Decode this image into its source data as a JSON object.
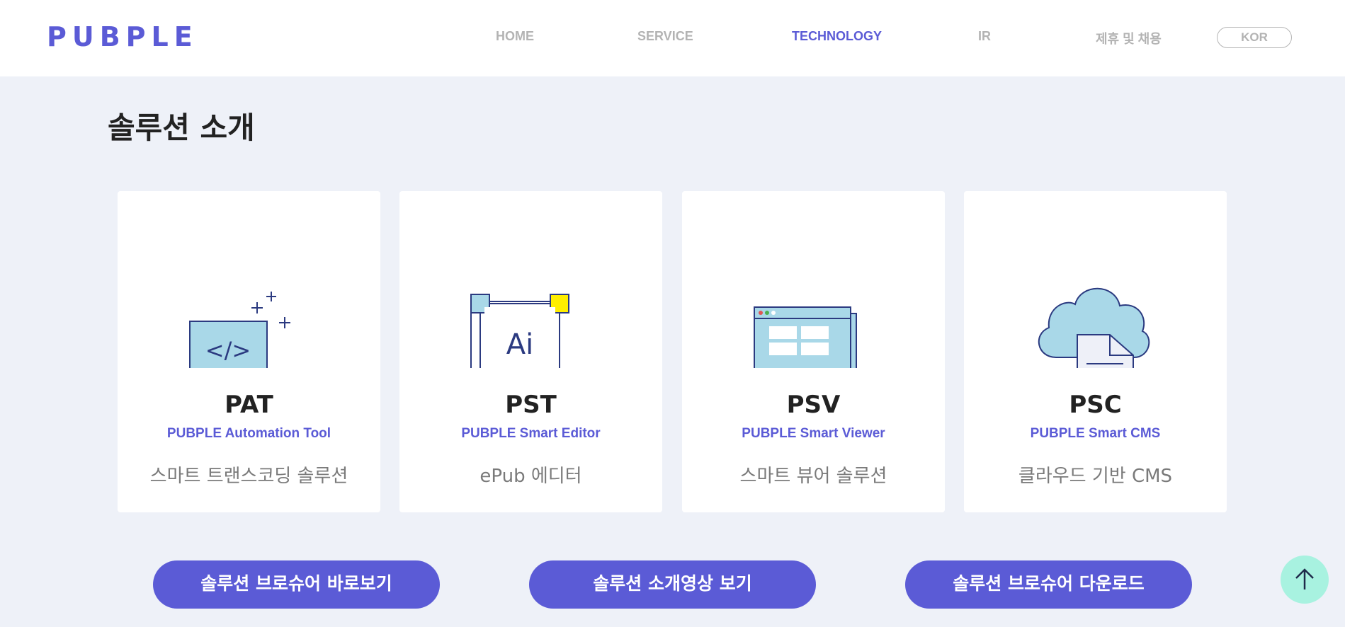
{
  "header": {
    "logo": "PUBPLE",
    "nav": [
      {
        "label": "HOME",
        "active": false
      },
      {
        "label": "SERVICE",
        "active": false
      },
      {
        "label": "TECHNOLOGY",
        "active": true
      },
      {
        "label": "IR",
        "active": false
      },
      {
        "label": "제휴 및 채용",
        "active": false
      }
    ],
    "language": "KOR"
  },
  "section": {
    "title": "솔루션 소개"
  },
  "solutions": [
    {
      "code": "PAT",
      "subtitle": "PUBPLE Automation Tool",
      "description": "스마트 트랜스코딩 솔루션",
      "icon": "monitor-code-icon"
    },
    {
      "code": "PST",
      "subtitle": "PUBPLE Smart Editor",
      "description": "ePub 에디터",
      "icon": "ai-editor-icon"
    },
    {
      "code": "PSV",
      "subtitle": "PUBPLE Smart Viewer",
      "description": "스마트 뷰어 솔루션",
      "icon": "browser-window-icon"
    },
    {
      "code": "PSC",
      "subtitle": "PUBPLE Smart CMS",
      "description": "클라우드 기반 CMS",
      "icon": "cloud-document-icon"
    }
  ],
  "icon_labels": {
    "code_tag": "</>",
    "ai": "Ai"
  },
  "actions": [
    {
      "label": "솔루션 브로슈어 바로보기"
    },
    {
      "label": "솔루션 소개영상 보기"
    },
    {
      "label": "솔루션 브로슈어 다운로드"
    }
  ],
  "scroll_top_icon": "arrow-up-icon",
  "colors": {
    "brand": "#5b5bd6",
    "nav_inactive": "#b3b3b3",
    "page_background": "#eef1f8",
    "card_background": "#ffffff",
    "icon_fill": "#a9d8e8",
    "icon_stroke": "#2b3a80",
    "icon_highlight": "#ffee00",
    "scroll_top_bg": "#a8f2e0"
  }
}
